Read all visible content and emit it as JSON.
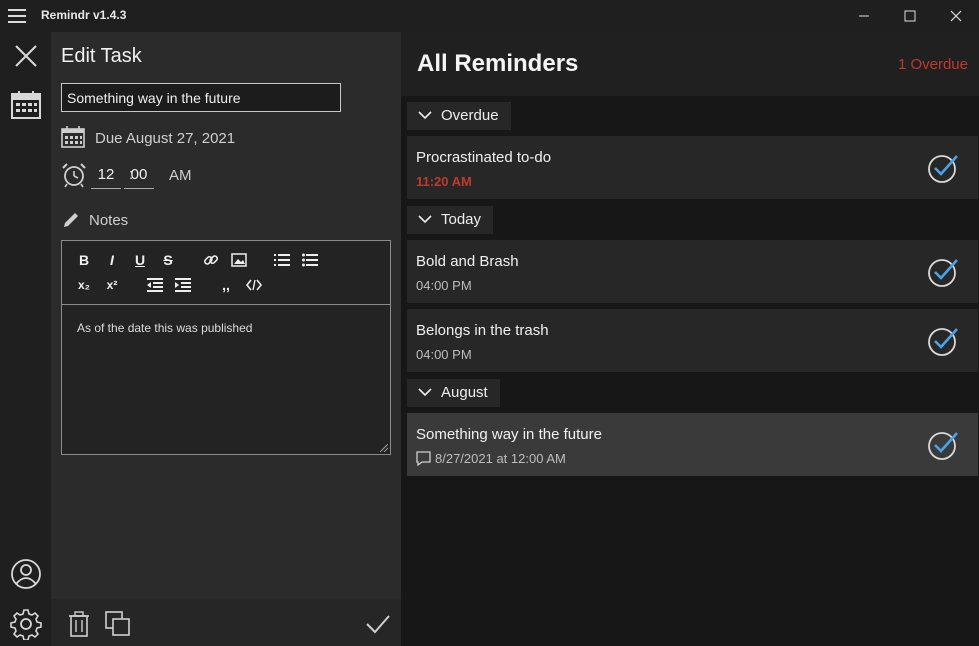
{
  "app": {
    "title": "Remindr v1.4.3"
  },
  "edit": {
    "heading": "Edit Task",
    "task_name": "Something way in the future",
    "due_label": "Due August 27, 2021",
    "hour": "12",
    "minute": "00",
    "colon": ":",
    "ampm": "AM",
    "notes_label": "Notes",
    "notes_content": "As of the date this was published",
    "toolbar": {
      "bold": "B",
      "italic": "I",
      "underline": "U",
      "strike": "S",
      "subscript": "x₂",
      "superscript": "x²",
      "quote": ",,"
    }
  },
  "list": {
    "title": "All Reminders",
    "overdue_count": "1 Overdue",
    "groups": [
      {
        "label": "Overdue"
      },
      {
        "label": "Today"
      },
      {
        "label": "August"
      }
    ],
    "items": [
      {
        "title": "Procrastinated to-do",
        "time": "11:20 AM"
      },
      {
        "title": "Bold and Brash",
        "time": "04:00 PM"
      },
      {
        "title": "Belongs in the trash",
        "time": "04:00 PM"
      },
      {
        "title": "Something way in the future",
        "time": "8/27/2021 at 12:00 AM"
      }
    ]
  },
  "colors": {
    "overdue": "#c0392b",
    "check_accent": "#4aa3e8",
    "selected_card": "#3a3a3a"
  },
  "icons": [
    "hamburger-icon",
    "minimize-icon",
    "maximize-icon",
    "close-icon",
    "calendar-icon",
    "alarm-clock-icon",
    "pencil-icon",
    "user-icon",
    "gear-icon",
    "trash-icon",
    "copy-icon",
    "checkmark-icon",
    "chevron-down-icon",
    "check-circle-icon",
    "note-icon"
  ]
}
